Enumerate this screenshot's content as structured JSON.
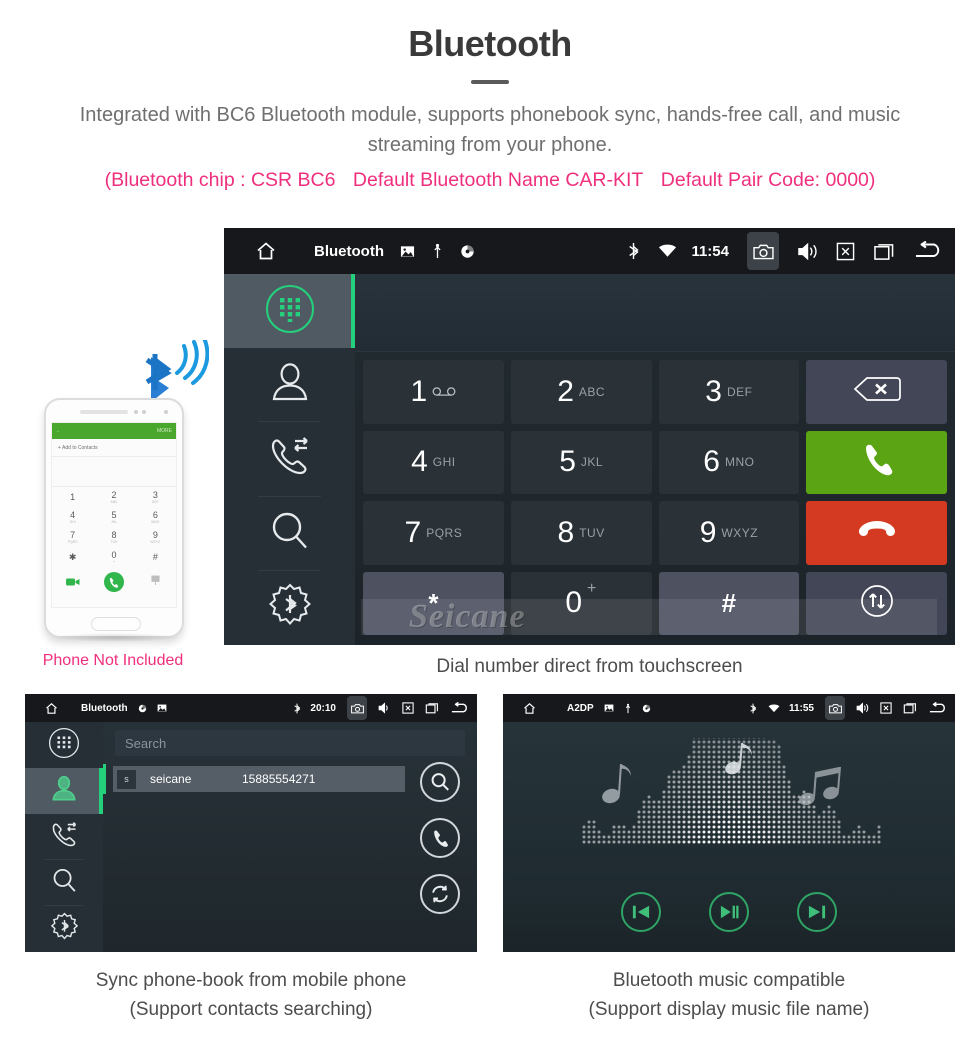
{
  "header": {
    "title": "Bluetooth",
    "subtitle": "Integrated with BC6 Bluetooth module, supports phonebook sync, hands-free call, and music streaming from your phone.",
    "spec_chip": "(Bluetooth chip : CSR BC6",
    "spec_name": "Default Bluetooth Name CAR-KIT",
    "spec_pair": "Default Pair Code: 0000)",
    "accent_pink": "#ef2f7d",
    "title_color": "#3a3a3a"
  },
  "main_unit": {
    "statusbar": {
      "home_icon": "home-icon",
      "title": "Bluetooth",
      "left_icons": [
        "image-icon",
        "usb-icon",
        "disc-icon"
      ],
      "bt_icon": "bluetooth-icon",
      "wifi_icon": "wifi-icon",
      "clock": "11:54",
      "right_icons": [
        "camera-icon",
        "volume-icon",
        "close-box-icon",
        "recents-icon",
        "back-icon"
      ]
    },
    "sidebar": [
      {
        "name": "dialpad",
        "icon": "dialpad-icon",
        "active": true
      },
      {
        "name": "contacts",
        "icon": "contact-icon",
        "active": false
      },
      {
        "name": "call-history",
        "icon": "call-history-icon",
        "active": false
      },
      {
        "name": "search",
        "icon": "search-icon",
        "active": false
      },
      {
        "name": "bluetooth-settings",
        "icon": "bluetooth-gear-icon",
        "active": false
      }
    ],
    "number_display_value": "",
    "keypad": [
      {
        "digit": "1",
        "letters": "",
        "sub_icon": "voicemail-icon"
      },
      {
        "digit": "2",
        "letters": "ABC"
      },
      {
        "digit": "3",
        "letters": "DEF"
      },
      {
        "digit": "",
        "letters": "",
        "action": "backspace",
        "icon": "backspace-icon",
        "style": "func"
      },
      {
        "digit": "4",
        "letters": "GHI"
      },
      {
        "digit": "5",
        "letters": "JKL"
      },
      {
        "digit": "6",
        "letters": "MNO"
      },
      {
        "digit": "",
        "letters": "",
        "action": "call",
        "icon": "call-icon",
        "style": "green"
      },
      {
        "digit": "7",
        "letters": "PQRS"
      },
      {
        "digit": "8",
        "letters": "TUV"
      },
      {
        "digit": "9",
        "letters": "WXYZ"
      },
      {
        "digit": "",
        "letters": "",
        "action": "hangup",
        "icon": "hangup-icon",
        "style": "red"
      },
      {
        "digit": "*",
        "letters": "",
        "style": "alt"
      },
      {
        "digit": "0",
        "letters": "+"
      },
      {
        "digit": "#",
        "letters": "",
        "style": "alt"
      },
      {
        "digit": "",
        "letters": "",
        "action": "transfer-audio",
        "icon": "transfer-icon",
        "style": "func"
      }
    ],
    "watermark": "Seicane",
    "accent_green": "#25d07d",
    "call_green": "#5ba515",
    "hangup_red": "#d43a22",
    "caption": "Dial number direct from touchscreen"
  },
  "phone_mock": {
    "bt_badge_icon": "bluetooth-signal-icon",
    "screen_bar_back": "←",
    "screen_bar_more": "MORE",
    "add_contact": "+   Add to Contacts",
    "keys": [
      {
        "d": "1",
        "s": ""
      },
      {
        "d": "2",
        "s": "ABC"
      },
      {
        "d": "3",
        "s": "DEF"
      },
      {
        "d": "4",
        "s": "GHI"
      },
      {
        "d": "5",
        "s": "JKL"
      },
      {
        "d": "6",
        "s": "MNO"
      },
      {
        "d": "7",
        "s": "PQRS"
      },
      {
        "d": "8",
        "s": "TUV"
      },
      {
        "d": "9",
        "s": "WXYZ"
      },
      {
        "d": "✱",
        "s": ""
      },
      {
        "d": "0",
        "s": "+"
      },
      {
        "d": "#",
        "s": ""
      }
    ],
    "note": "Phone Not Included"
  },
  "phonebook_unit": {
    "statusbar": {
      "title": "Bluetooth",
      "left_icons": [
        "disc-icon",
        "image-icon"
      ],
      "clock": "20:10",
      "right_icons": [
        "camera-icon",
        "volume-icon",
        "close-box-icon",
        "recents-icon",
        "back-icon"
      ]
    },
    "sidebar": [
      {
        "name": "dialpad",
        "icon": "dialpad-icon",
        "active": false
      },
      {
        "name": "contacts",
        "icon": "contact-icon",
        "active": true
      },
      {
        "name": "call-history",
        "icon": "call-history-icon",
        "active": false
      },
      {
        "name": "search",
        "icon": "search-icon",
        "active": false
      },
      {
        "name": "bluetooth-settings",
        "icon": "bluetooth-gear-icon",
        "active": false
      }
    ],
    "search_placeholder": "Search",
    "search_value": "",
    "contact": {
      "initial": "s",
      "name": "seicane",
      "number": "15885554271"
    },
    "actions": [
      "search-icon",
      "call-icon",
      "sync-icon"
    ],
    "caption_line1": "Sync phone-book from mobile phone",
    "caption_line2": "(Support contacts searching)"
  },
  "music_unit": {
    "statusbar": {
      "title": "A2DP",
      "left_icons": [
        "image-icon",
        "usb-icon",
        "disc-icon"
      ],
      "clock": "11:55",
      "right_icons": [
        "camera-icon",
        "volume-icon",
        "close-box-icon",
        "recents-icon",
        "back-icon"
      ]
    },
    "visualizer": "dot-matrix-equalizer",
    "controls": [
      {
        "name": "previous",
        "icon": "previous-icon"
      },
      {
        "name": "play-pause",
        "icon": "play-pause-icon"
      },
      {
        "name": "next",
        "icon": "next-icon"
      }
    ],
    "control_green": "#2fa565",
    "caption_line1": "Bluetooth music compatible",
    "caption_line2": "(Support display music file name)"
  }
}
